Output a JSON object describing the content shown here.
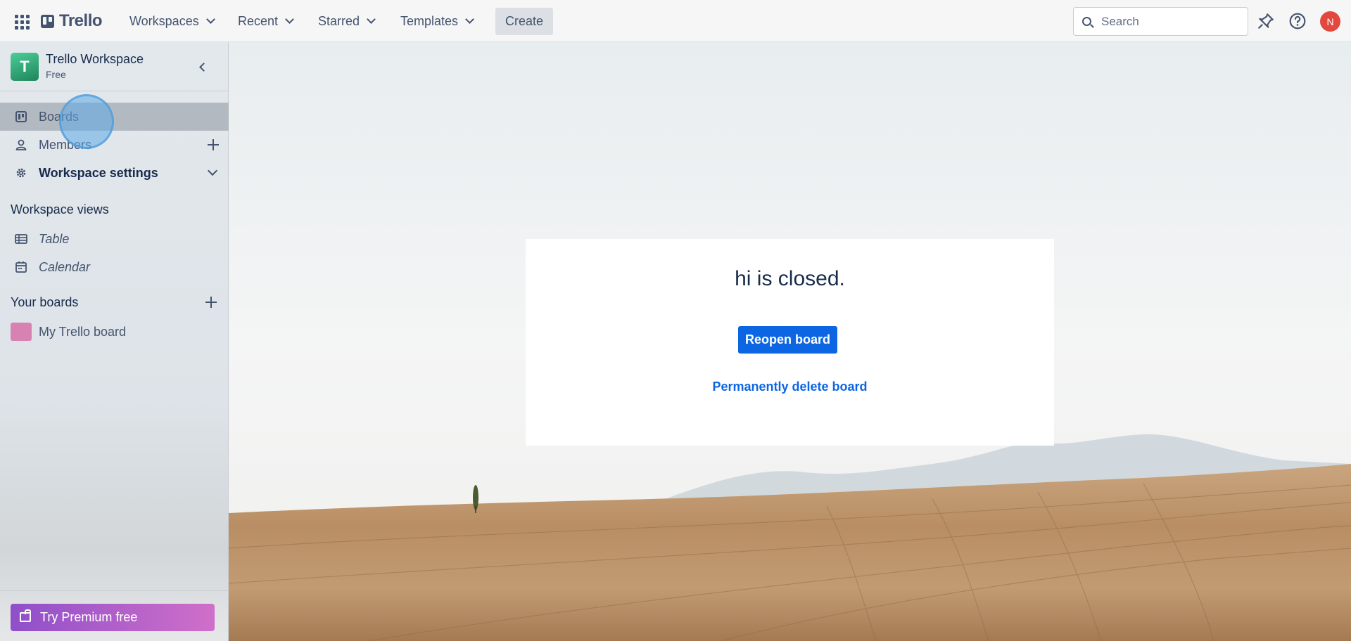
{
  "topbar": {
    "logo_text": "Trello",
    "nav": [
      {
        "label": "Workspaces"
      },
      {
        "label": "Recent"
      },
      {
        "label": "Starred"
      },
      {
        "label": "Templates"
      }
    ],
    "create_label": "Create",
    "search_placeholder": "Search",
    "avatar_initial": "N",
    "icons": [
      "apps-grid-icon",
      "notifications-icon",
      "help-icon"
    ]
  },
  "sidebar": {
    "workspace_name": "Trello Workspace",
    "workspace_plan": "Free",
    "workspace_initial": "T",
    "items": [
      {
        "label": "Boards",
        "icon": "board-icon"
      },
      {
        "label": "Members",
        "icon": "person-icon"
      },
      {
        "label": "Workspace settings",
        "icon": "gear-icon"
      }
    ],
    "views_title": "Workspace views",
    "views": [
      {
        "label": "Table",
        "icon": "table-icon"
      },
      {
        "label": "Calendar",
        "icon": "calendar-icon"
      }
    ],
    "boards_title": "Your boards",
    "boards": [
      {
        "label": "My Trello board",
        "color": "#d882b2"
      }
    ],
    "premium_label": "Try Premium free"
  },
  "main": {
    "closed_message": "hi is closed.",
    "reopen_label": "Reopen board",
    "delete_label": "Permanently delete board"
  },
  "colors": {
    "primary": "#0c66e4",
    "avatar": "#e2483d",
    "workspace_badge": "#1f845a"
  }
}
